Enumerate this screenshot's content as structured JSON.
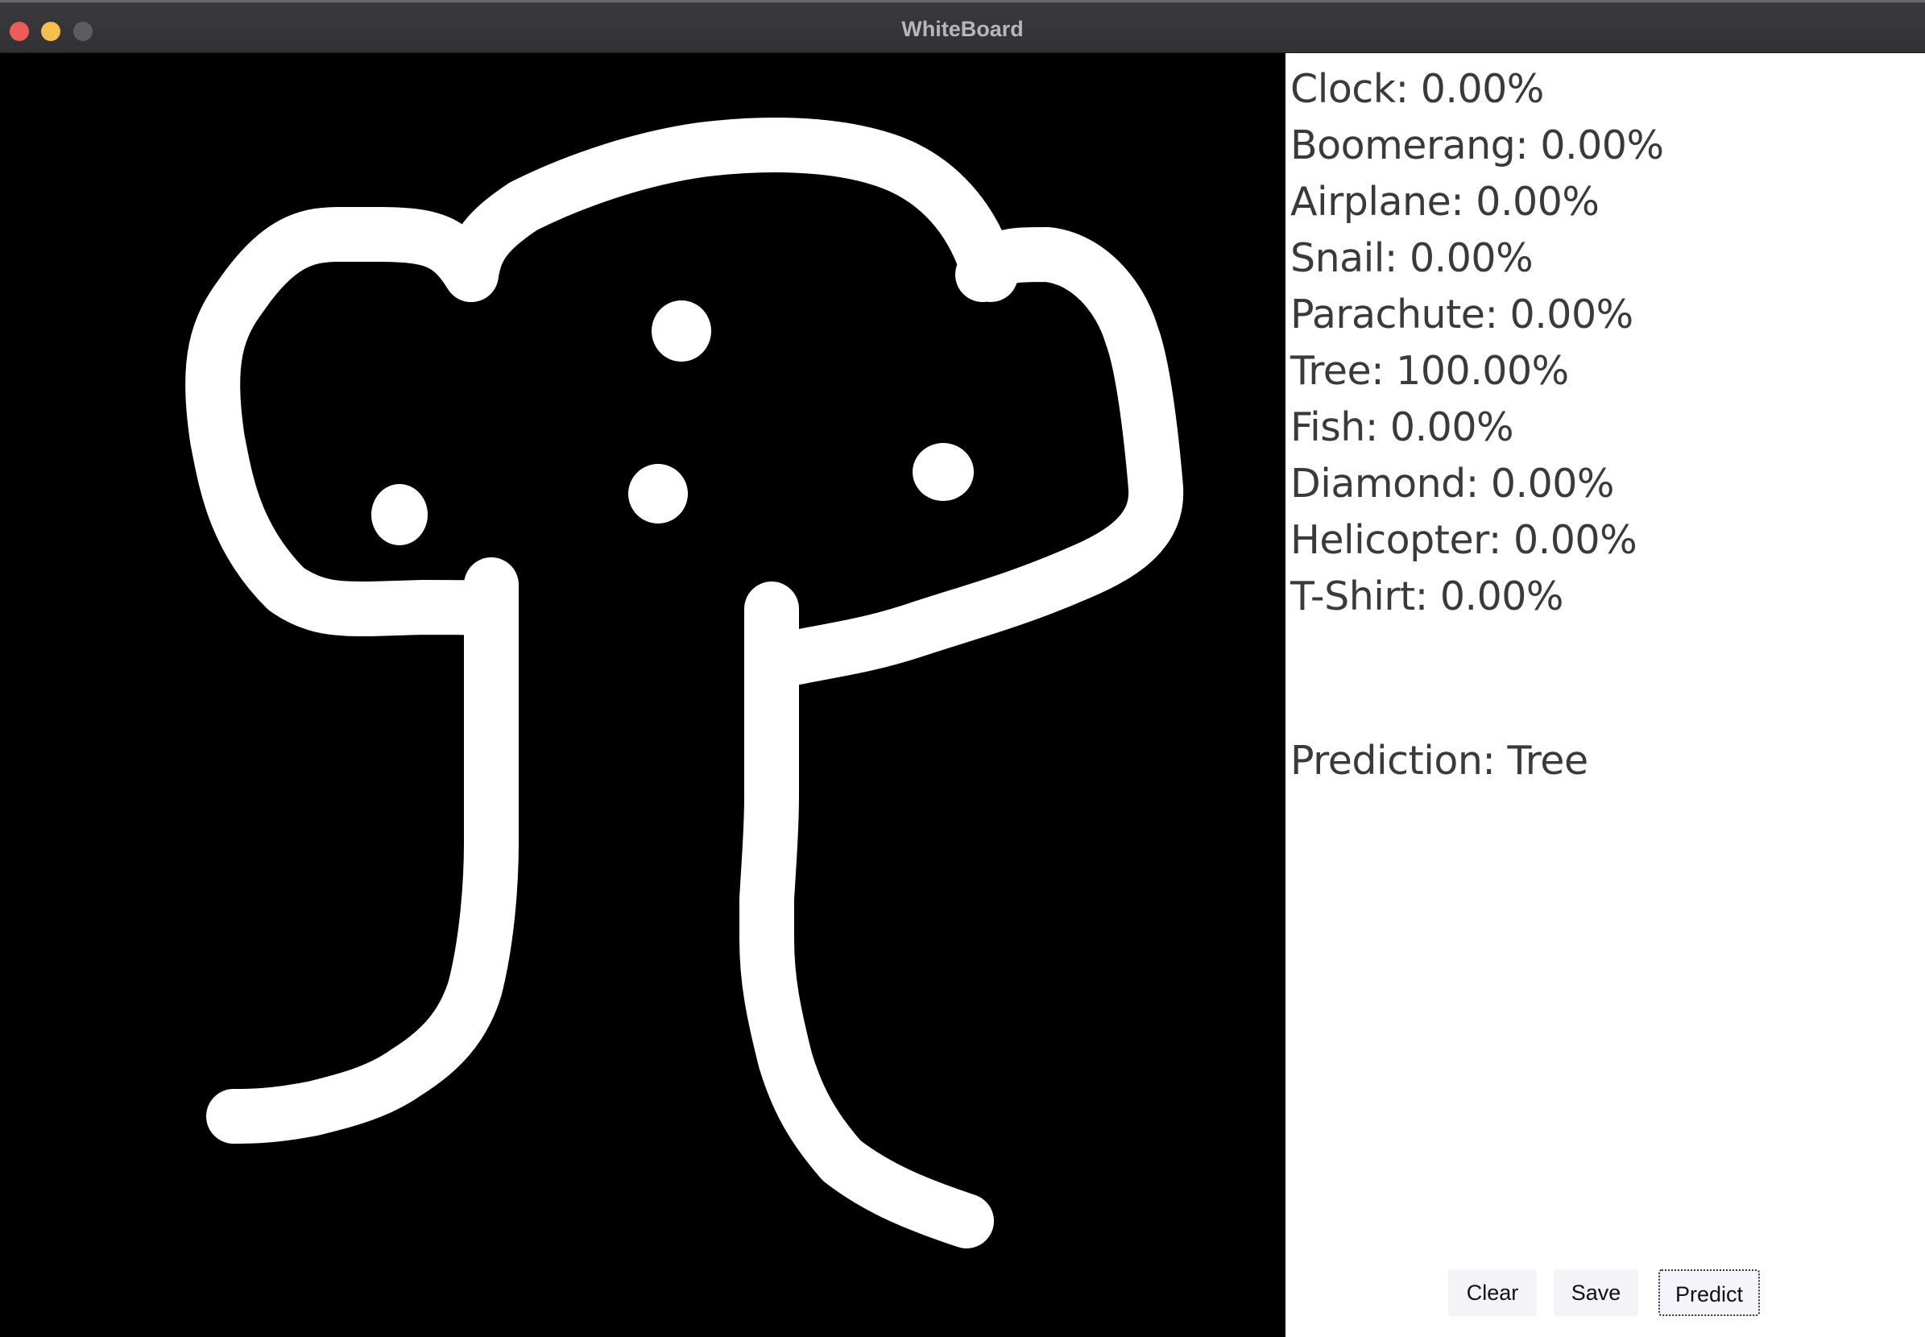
{
  "window": {
    "title": "WhiteBoard"
  },
  "scores": [
    {
      "label": "Clock: 0.00%"
    },
    {
      "label": "Boomerang: 0.00%"
    },
    {
      "label": "Airplane: 0.00%"
    },
    {
      "label": "Snail: 0.00%"
    },
    {
      "label": "Parachute: 0.00%"
    },
    {
      "label": "Tree: 100.00%"
    },
    {
      "label": "Fish: 0.00%"
    },
    {
      "label": "Diamond: 0.00%"
    },
    {
      "label": "Helicopter: 0.00%"
    },
    {
      "label": "T-Shirt: 0.00%"
    }
  ],
  "prediction": {
    "text": "Prediction: Tree"
  },
  "buttons": {
    "clear": "Clear",
    "save": "Save",
    "predict": "Predict"
  },
  "colors": {
    "canvas_background": "#000000",
    "stroke": "#ffffff",
    "panel_background": "#ffffff",
    "text": "#3a3a3a"
  }
}
